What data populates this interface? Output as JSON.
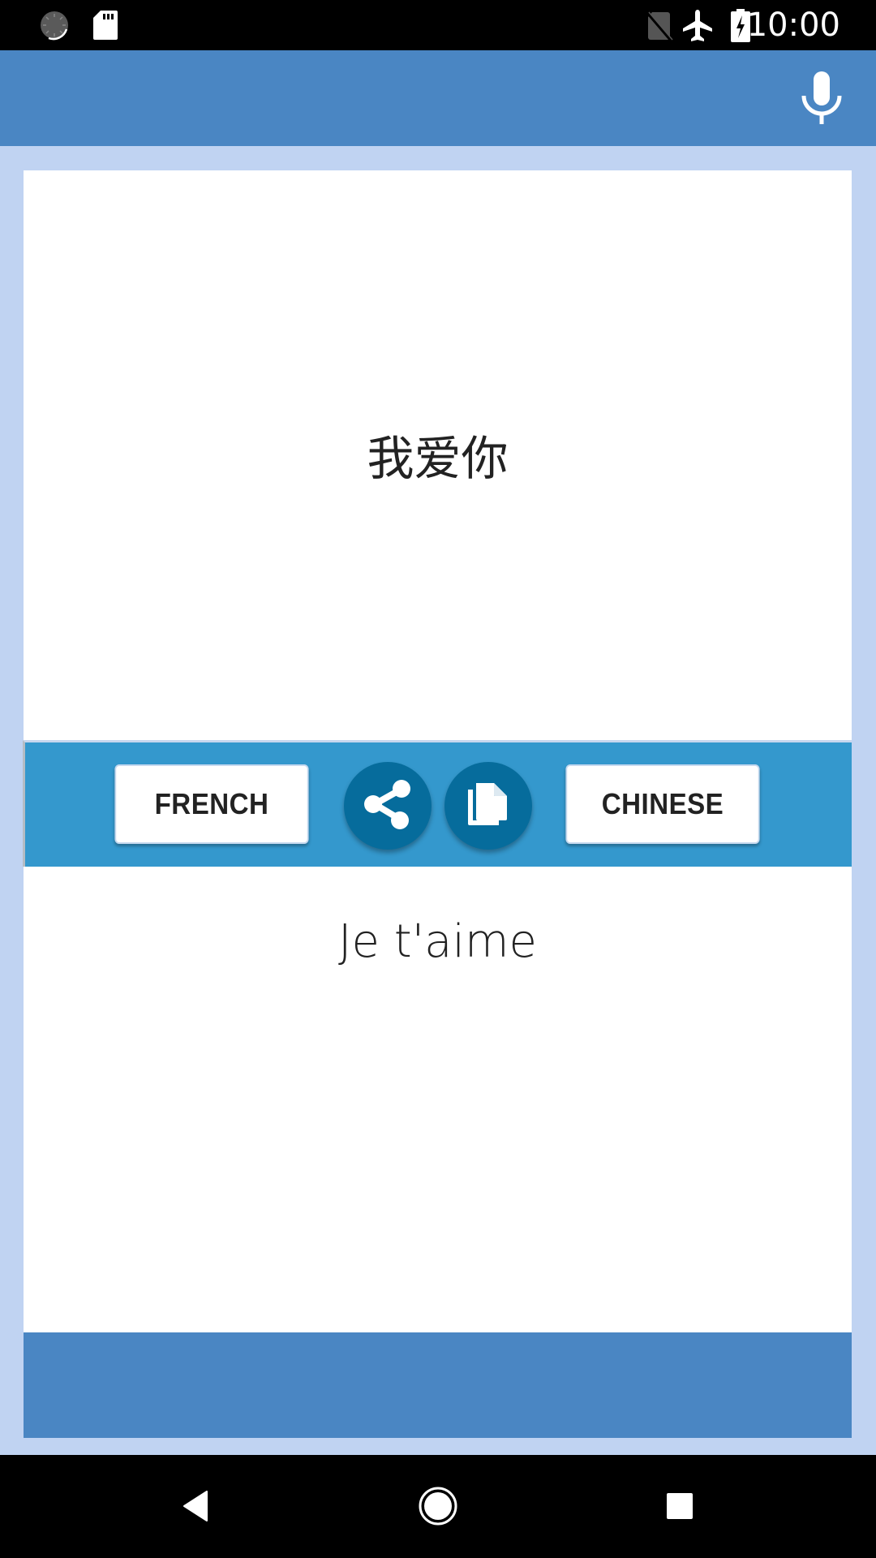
{
  "status_bar": {
    "time": "10:00",
    "icons_left": [
      "sync-loading-icon",
      "sd-card-icon"
    ],
    "icons_right": [
      "no-sim-icon",
      "airplane-mode-icon",
      "battery-charging-icon"
    ]
  },
  "app_bar": {
    "action_icon": "microphone-icon"
  },
  "translation": {
    "source_text": "我爱你",
    "target_text": "Je t'aime"
  },
  "toolbar": {
    "left_language": "FRENCH",
    "right_language": "CHINESE",
    "share_icon": "share-icon",
    "copy_icon": "copy-icon"
  },
  "nav_bar": {
    "buttons": [
      "back",
      "home",
      "recents"
    ]
  },
  "colors": {
    "app_bar": "#4a86c3",
    "background": "#c0d3f2",
    "toolbar": "#3498cd",
    "fab": "#066c9c"
  }
}
